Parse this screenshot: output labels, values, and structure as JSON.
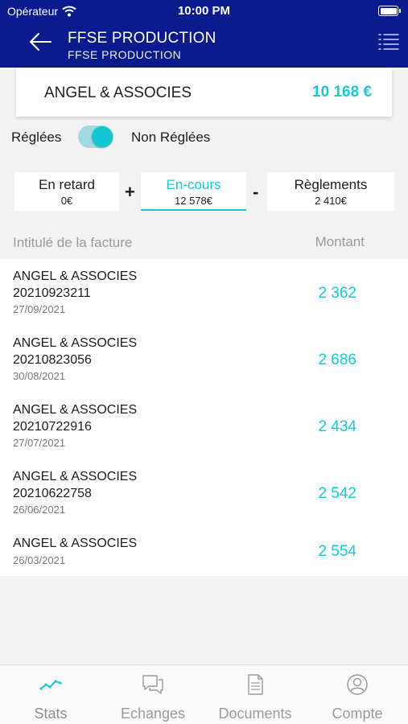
{
  "status_bar": {
    "carrier": "Opérateur",
    "time": "10:00 PM"
  },
  "header": {
    "title": "FFSE PRODUCTION",
    "subtitle": "FFSE PRODUCTION"
  },
  "client": {
    "name": "ANGEL & ASSOCIES",
    "total": "10 168 €"
  },
  "toggle": {
    "left_label": "Réglées",
    "right_label": "Non Réglées",
    "state": "on"
  },
  "filters": [
    {
      "label": "En retard",
      "value": "0€"
    },
    {
      "label": "En-cours",
      "value": "12 578€"
    },
    {
      "label": "Règlements",
      "value": "2 410€"
    }
  ],
  "operators": {
    "plus": "+",
    "minus": "-"
  },
  "table": {
    "col_title": "Intitulé de la facture",
    "col_amount": "Montant",
    "rows": [
      {
        "name": "ANGEL & ASSOCIES",
        "number": "20210923211",
        "date": "27/09/2021",
        "amount": "2 362"
      },
      {
        "name": "ANGEL & ASSOCIES",
        "number": "20210823056",
        "date": "30/08/2021",
        "amount": "2 686"
      },
      {
        "name": "ANGEL & ASSOCIES",
        "number": "20210722916",
        "date": "27/07/2021",
        "amount": "2 434"
      },
      {
        "name": "ANGEL & ASSOCIES",
        "number": "20210622758",
        "date": "26/06/2021",
        "amount": "2 542"
      },
      {
        "name": "ANGEL & ASSOCIES",
        "number": "",
        "date": "26/03/2021",
        "amount": "2 554"
      }
    ]
  },
  "tabs": [
    {
      "label": "Stats",
      "icon": "stats-icon"
    },
    {
      "label": "Echanges",
      "icon": "chat-icon"
    },
    {
      "label": "Documents",
      "icon": "document-icon"
    },
    {
      "label": "Compte",
      "icon": "account-icon"
    }
  ],
  "colors": {
    "nav": "#0b1a8c",
    "accent": "#1ac8d2"
  }
}
